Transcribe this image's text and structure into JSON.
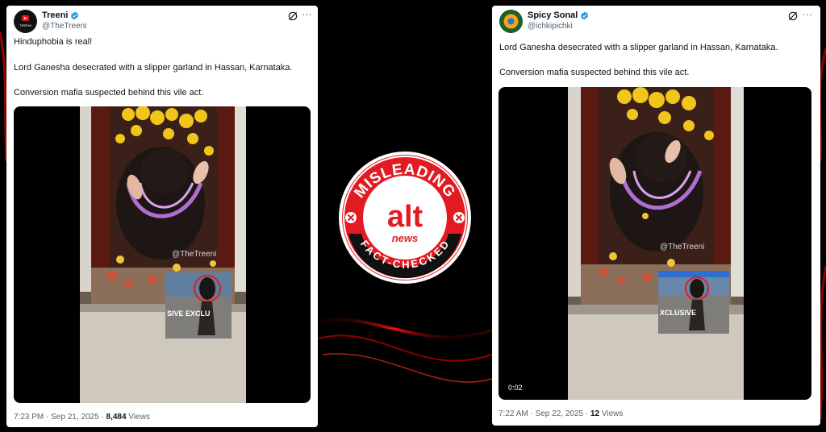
{
  "left_tweet": {
    "author_name": "Treeni",
    "author_handle": "@TheTreeni",
    "avatar_label": "TREENI",
    "text_line1": "Hinduphobia is real!",
    "text_line2": "Lord Ganesha desecrated with a slipper garland in Hassan, Karnataka.",
    "text_line3": "Conversion mafia suspected behind this vile act.",
    "video_watermark": "@TheTreeni",
    "inset_text": "SIVE      EXCLU",
    "footer_time": "7:23 PM · Sep 21, 2025 · ",
    "footer_views_count": "8,484",
    "footer_views_label": " Views"
  },
  "right_tweet": {
    "author_name": "Spicy Sonal",
    "author_handle": "@ichkipichki",
    "text_line1": "Lord Ganesha desecrated with a slipper garland in Hassan, Karnataka.",
    "text_line2": "Conversion mafia suspected behind this vile act.",
    "video_watermark": "@TheTreeni",
    "inset_text": "XCLUSIVE",
    "video_duration": "0:02",
    "footer_time": "7:22 AM · Sep 22, 2025 · ",
    "footer_views_count": "12",
    "footer_views_label": " Views"
  },
  "badge": {
    "top_text": "MISLEADING",
    "logo_main": "alt",
    "logo_sub": "news",
    "bottom_text": "FACT-CHECKED"
  },
  "colors": {
    "badge_red": "#e21b23",
    "verified_blue": "#1d9bf0",
    "text_gray": "#536471"
  },
  "icons": [
    "verified-icon",
    "grok-icon",
    "more-icon",
    "cross-icon"
  ]
}
